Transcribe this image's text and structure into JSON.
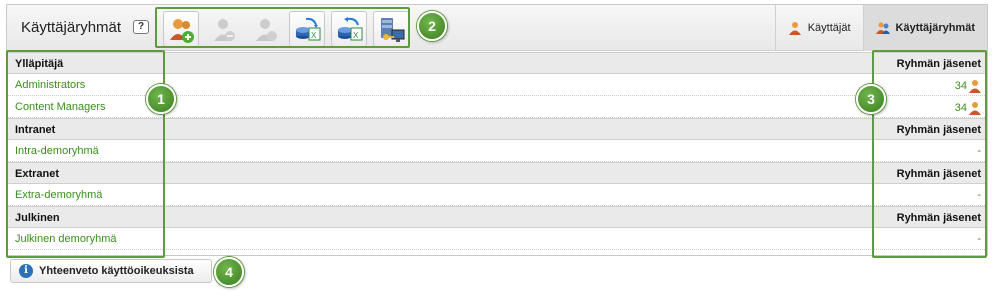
{
  "header": {
    "title": "Käyttäjäryhmät",
    "help_label": "?"
  },
  "toolbar": {
    "buttons": [
      {
        "icon": "add-group-icon",
        "enabled": true
      },
      {
        "icon": "remove-user-icon",
        "enabled": false
      },
      {
        "icon": "user-icon",
        "enabled": false
      },
      {
        "icon": "import-excel-icon",
        "enabled": true
      },
      {
        "icon": "export-excel-icon",
        "enabled": true
      },
      {
        "icon": "server-permissions-icon",
        "enabled": true
      }
    ]
  },
  "tabs": [
    {
      "label": "Käyttäjät",
      "active": false
    },
    {
      "label": "Käyttäjäryhmät",
      "active": true
    }
  ],
  "groups": [
    {
      "category": "Ylläpitäjä",
      "column": "Ryhmän jäsenet",
      "items": [
        {
          "name": "Administrators",
          "members": "34"
        },
        {
          "name": "Content Managers",
          "members": "34"
        }
      ]
    },
    {
      "category": "Intranet",
      "column": "Ryhmän jäsenet",
      "items": [
        {
          "name": "Intra-demoryhmä",
          "members": "-"
        }
      ]
    },
    {
      "category": "Extranet",
      "column": "Ryhmän jäsenet",
      "items": [
        {
          "name": "Extra-demoryhmä",
          "members": "-"
        }
      ]
    },
    {
      "category": "Julkinen",
      "column": "Ryhmän jäsenet",
      "items": [
        {
          "name": "Julkinen demoryhmä",
          "members": "-"
        }
      ]
    }
  ],
  "summary_button": {
    "label": "Yhteenveto käyttöoikeuksista"
  },
  "callouts": [
    "1",
    "2",
    "3",
    "4"
  ],
  "colors": {
    "accent_green": "#5e9b3f",
    "link_green": "#3a8f1b",
    "info_blue": "#2f6fb8"
  }
}
